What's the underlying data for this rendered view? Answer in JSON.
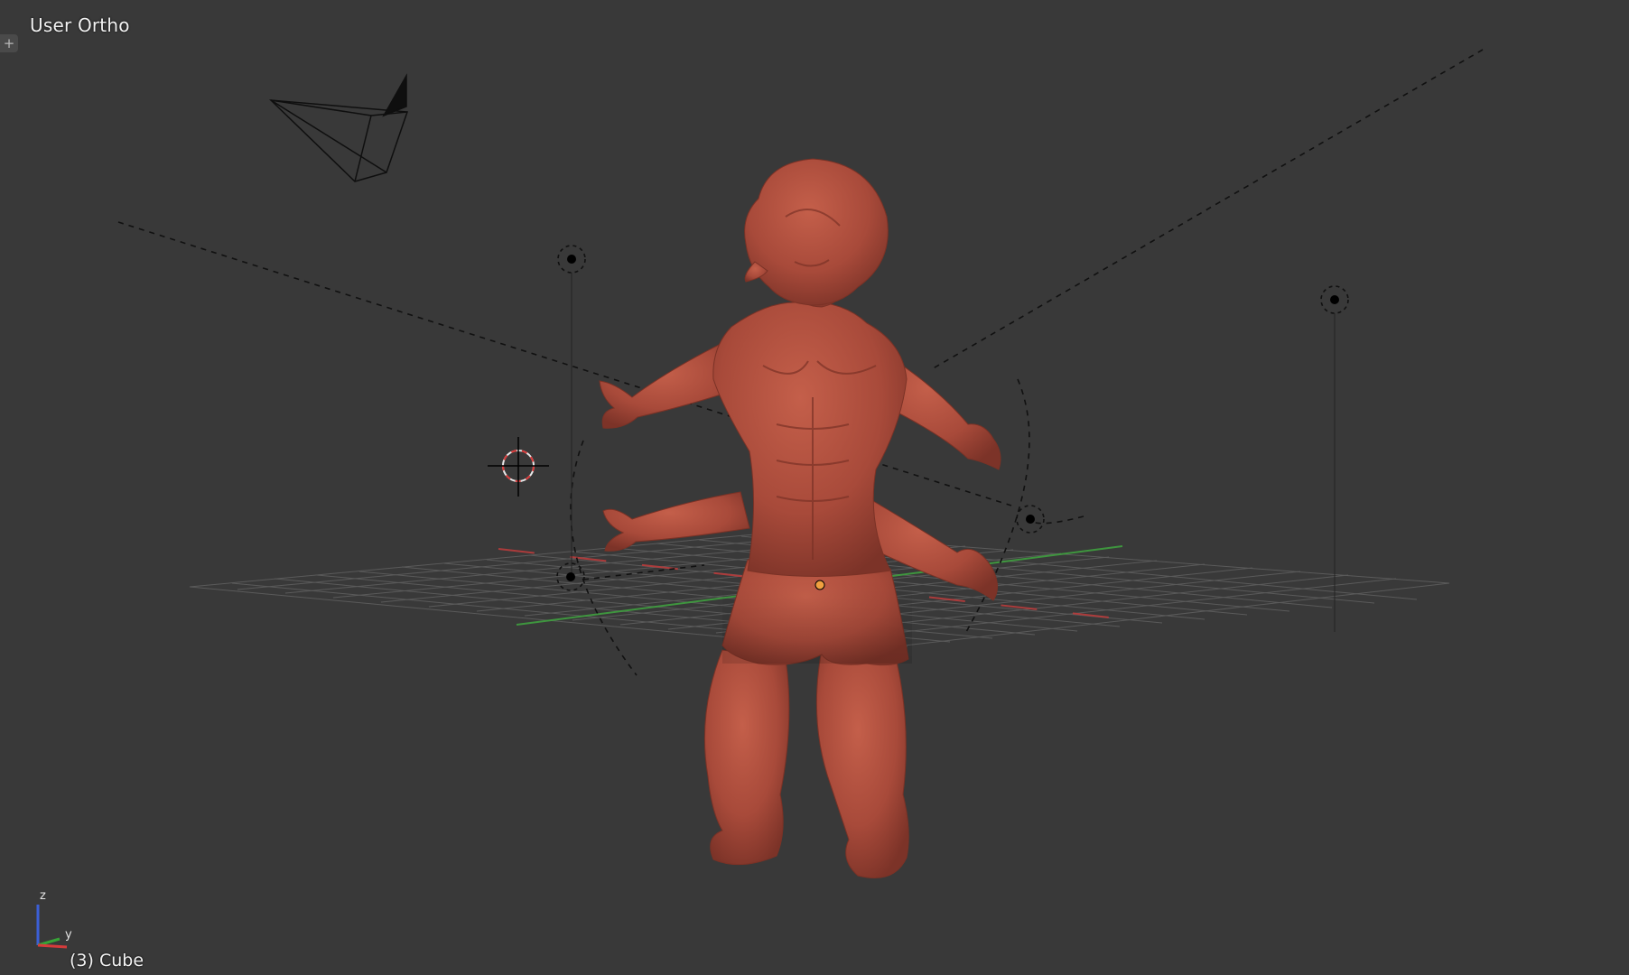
{
  "viewport": {
    "view_label": "User Ortho",
    "object_label": "(3) Cube",
    "add_tab_icon": "plus-icon"
  },
  "axis_gizmo": {
    "z_label": "z",
    "y_label": "y",
    "colors": {
      "x": "#d63b3b",
      "y": "#37a337",
      "z": "#3b5fd6"
    }
  },
  "colors": {
    "background": "#393939",
    "mesh": "#a84a3a",
    "grid": "#5c5c5c",
    "x_axis": "#b83c3c",
    "y_axis": "#3fa03f",
    "origin": "#f0a040"
  }
}
